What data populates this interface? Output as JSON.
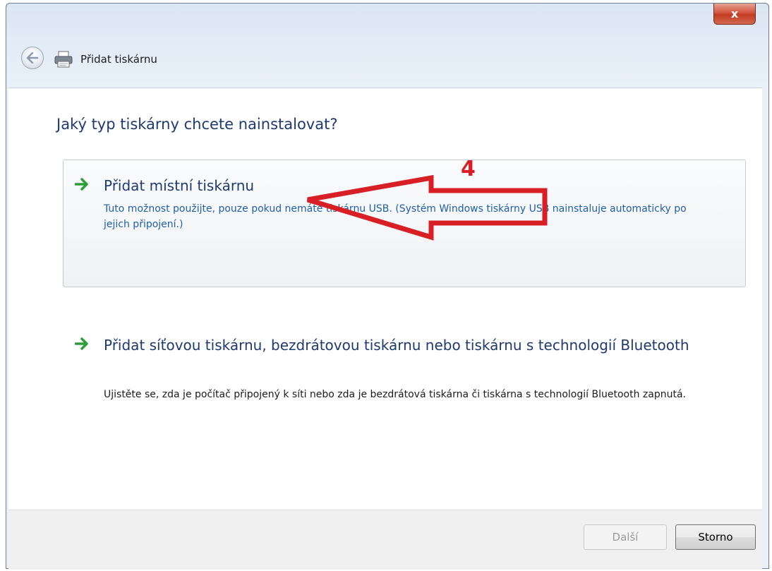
{
  "window": {
    "title": "Přidat tiskárnu",
    "close_label": "x"
  },
  "main": {
    "question": "Jaký typ tiskárny chcete nainstalovat?",
    "options": [
      {
        "title": "Přidat místní tiskárnu",
        "description": "Tuto možnost použijte, pouze pokud nemáte tiskárnu USB. (Systém Windows tiskárny USB nainstaluje automaticky po jejich připojení.)"
      },
      {
        "title": "Přidat síťovou tiskárnu, bezdrátovou tiskárnu nebo tiskárnu s technologií Bluetooth",
        "description": "Ujistěte se, zda je počítač připojený k síti nebo zda je bezdrátová tiskárna či tiskárna s technologií Bluetooth zapnutá."
      }
    ]
  },
  "buttons": {
    "next": "Další",
    "cancel": "Storno"
  },
  "annotation": {
    "number": "4",
    "color": "#d91f26"
  },
  "colors": {
    "heading": "#1e3a6e",
    "option_description": "#1f5fa8",
    "body_text": "#1b1b1b",
    "arrow_green": "#2e9e3a"
  }
}
